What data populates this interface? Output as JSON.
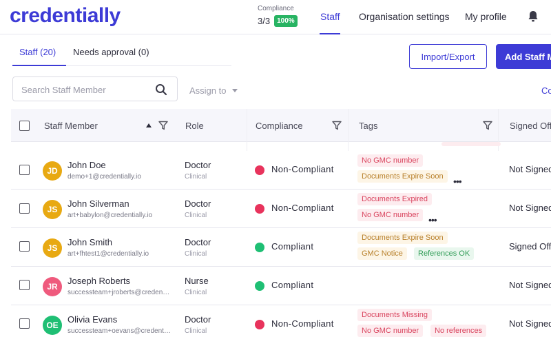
{
  "header": {
    "logo": "credentially",
    "compliance": {
      "label": "Compliance",
      "count": "3/3",
      "badge": "100%"
    },
    "nav": [
      "Staff",
      "Organisation settings",
      "My profile"
    ],
    "bell_icon": "bell-icon"
  },
  "subtabs": [
    "Staff (20)",
    "Needs approval (0)"
  ],
  "actions": {
    "import_export": "Import/Export",
    "add_staff": "Add Staff Member"
  },
  "search": {
    "placeholder": "Search Staff Member"
  },
  "assign_to": "Assign to",
  "columns_link": "Columns",
  "table": {
    "headers": [
      "Staff Member",
      "Role",
      "Compliance",
      "Tags",
      "Signed Off"
    ],
    "rows": [
      {
        "initials": "JD",
        "avatar_color": "#e8a912",
        "name": "John Doe",
        "email": "demo+1@credentially.io",
        "role": "Doctor",
        "role_sub": "Clinical",
        "status": "Non-Compliant",
        "status_color": "#e8335c",
        "tags": [
          {
            "text": "No GMC number"
          },
          {
            "text": "Documents Expire Soon"
          }
        ],
        "signed": "Not Signed Off"
      },
      {
        "initials": "JS",
        "avatar_color": "#e8a912",
        "name": "John Silverman",
        "email": "art+babylon@credentially.io",
        "role": "Doctor",
        "role_sub": "Clinical",
        "status": "Non-Compliant",
        "status_color": "#e8335c",
        "tags": [
          {
            "text": "Documents Expired"
          },
          {
            "text": "No GMC number"
          }
        ],
        "signed": "Not Signed Off"
      },
      {
        "initials": "JS",
        "avatar_color": "#e8a912",
        "name": "John Smith",
        "email": "art+fhtest1@credentially.io",
        "role": "Doctor",
        "role_sub": "Clinical",
        "status": "Compliant",
        "status_color": "#1fbf74",
        "tags": [
          {
            "text": "Documents Expire Soon"
          },
          {
            "text": "GMC Notice"
          },
          {
            "text": "References OK"
          }
        ],
        "signed": "Signed Off"
      },
      {
        "initials": "JR",
        "avatar_color": "#ef5a7d",
        "name": "Joseph Roberts",
        "email": "successteam+jroberts@credentially.io",
        "role": "Nurse",
        "role_sub": "Clinical",
        "status": "Compliant",
        "status_color": "#1fbf74",
        "tags": [],
        "signed": "Not Signed Off"
      },
      {
        "initials": "OE",
        "avatar_color": "#1fbf74",
        "name": "Olivia Evans",
        "email": "successteam+oevans@credentially.io",
        "role": "Doctor",
        "role_sub": "Clinical",
        "status": "Non-Compliant",
        "status_color": "#e8335c",
        "tags": [
          {
            "text": "Documents Missing"
          },
          {
            "text": "No GMC number"
          },
          {
            "text": "No references"
          }
        ],
        "signed": "Not Signed Off"
      }
    ]
  }
}
